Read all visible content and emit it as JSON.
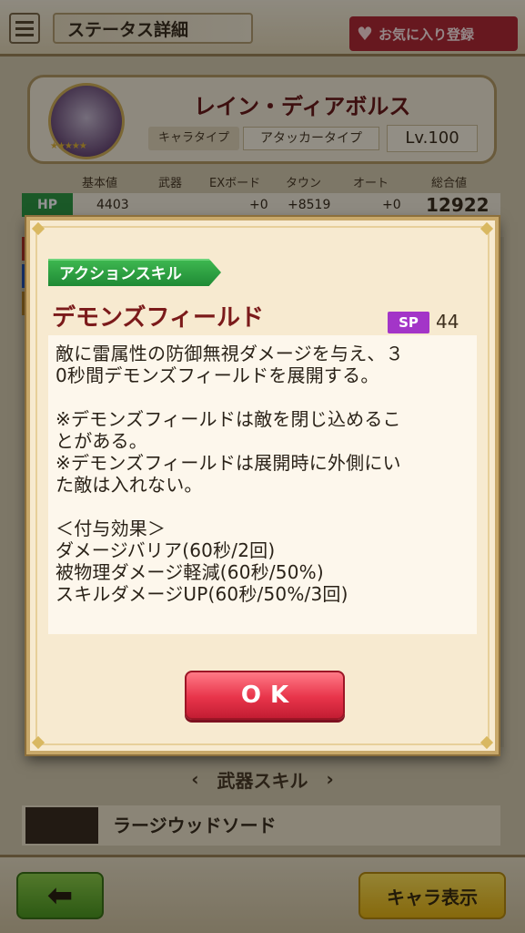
{
  "header": {
    "title": "ステータス詳細",
    "favorite_label": "お気に入り登録"
  },
  "character": {
    "name": "レイン・ディアボルス",
    "type_label": "キャラタイプ",
    "type_value": "アタッカータイプ",
    "level": "Lv.100",
    "stars": "★★★★★"
  },
  "stats": {
    "headers": [
      "基本値",
      "武器",
      "EXボード",
      "タウン",
      "オート",
      "総合値"
    ],
    "hp": {
      "label": "HP",
      "base": "4403",
      "weapon": "",
      "ex_board": "+0",
      "town": "+8519",
      "auto": "+0",
      "total": "12922"
    }
  },
  "modal": {
    "badge": "アクションスキル",
    "skill_name": "デモンズフィールド",
    "sp_label": "SP",
    "sp_value": "44",
    "description_lines": [
      "敵に雷属性の防御無視ダメージを与え、３",
      "0秒間デモンズフィールドを展開する。",
      "",
      "※デモンズフィールドは敵を閉じ込めるこ",
      "とがある。",
      "※デモンズフィールドは展開時に外側にい",
      "た敵は入れない。",
      "",
      "＜付与効果＞",
      "ダメージバリア(60秒/2回)",
      "被物理ダメージ軽減(60秒/50%)",
      "スキルダメージUP(60秒/50%/3回)"
    ],
    "ok_label": "OK"
  },
  "weapon_section": {
    "title": "武器スキル",
    "weapon_name": "ラージウッドソード"
  },
  "footer": {
    "back_icon": "left-arrow-icon",
    "chara_button": "キャラ表示"
  },
  "colors": {
    "accent_red": "#e8344a",
    "skill_green": "#1f8a35",
    "sp_purple": "#a335c8",
    "title_maroon": "#7b1a1a"
  }
}
